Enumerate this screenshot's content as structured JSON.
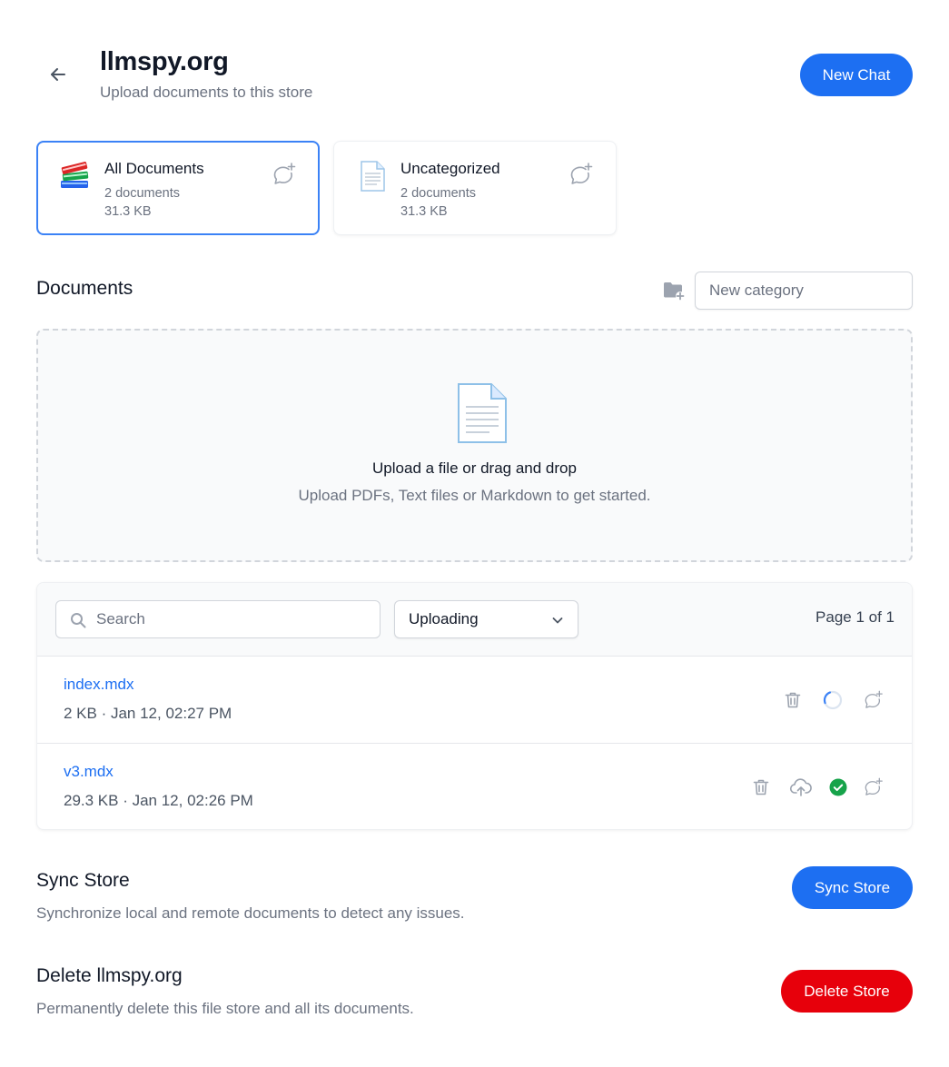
{
  "header": {
    "title": "llmspy.org",
    "subtitle": "Upload documents to this store",
    "new_chat_label": "New Chat"
  },
  "categories": [
    {
      "name": "All Documents",
      "count": "2 documents",
      "size": "31.3 KB",
      "icon": "books-icon",
      "selected": true
    },
    {
      "name": "Uncategorized",
      "count": "2 documents",
      "size": "31.3 KB",
      "icon": "document-icon",
      "selected": false
    }
  ],
  "documents": {
    "heading": "Documents",
    "new_category_placeholder": "New category"
  },
  "dropzone": {
    "title": "Upload a file or drag and drop",
    "subtitle": "Upload PDFs, Text files or Markdown to get started."
  },
  "files": {
    "search_placeholder": "Search",
    "status_filter": "Uploading",
    "page_info": "Page 1 of 1",
    "rows": [
      {
        "name": "index.mdx",
        "meta": "2 KB · Jan 12, 02:27 PM",
        "status": "uploading"
      },
      {
        "name": "v3.mdx",
        "meta": "29.3 KB · Jan 12, 02:26 PM",
        "status": "synced"
      }
    ]
  },
  "sync": {
    "title": "Sync Store",
    "description": "Synchronize local and remote documents to detect any issues.",
    "button_label": "Sync Store"
  },
  "delete": {
    "title": "Delete llmspy.org",
    "description": "Permanently delete this file store and all its documents.",
    "button_label": "Delete Store"
  },
  "colors": {
    "primary": "#1d6ff2",
    "danger": "#e7000b",
    "success": "#16a34a",
    "selected_border": "#3b82f6"
  }
}
